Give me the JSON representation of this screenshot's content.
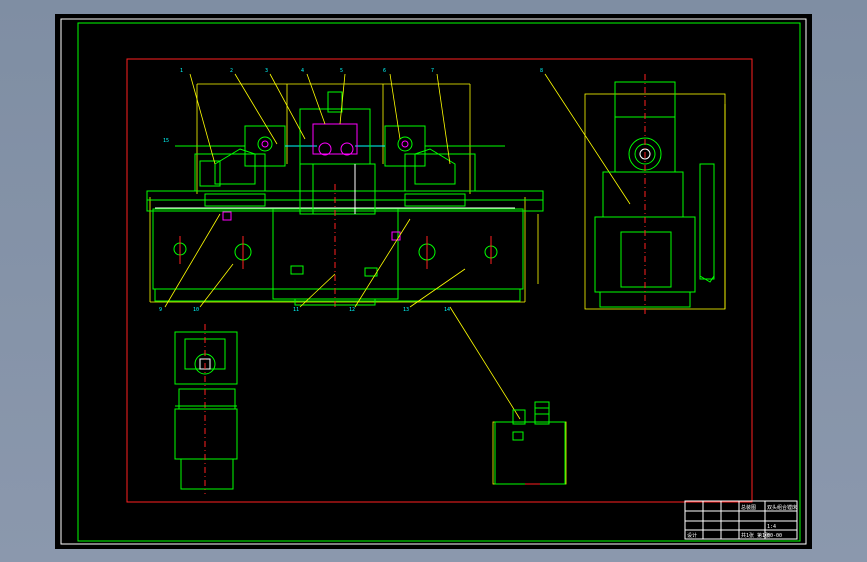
{
  "drawing": {
    "balloons": [
      "1",
      "2",
      "3",
      "4",
      "5",
      "6",
      "7",
      "8",
      "9",
      "10",
      "11",
      "12",
      "13",
      "14",
      "15"
    ],
    "title_block": {
      "name": "总装图",
      "project": "双头组合镗床",
      "drawing_no": "00-00",
      "scale": "1:4",
      "sheet": "共1张 第1张",
      "school": "设计",
      "rows": [
        "标记",
        "处数",
        "分区",
        "更改文件号",
        "签名",
        "日期"
      ]
    },
    "colors": {
      "background": "#000000",
      "outline": "#00ff00",
      "dimension": "#ffff00",
      "centerline": "#ff2020",
      "highlight": "#ff00ff",
      "frame": "#ffffff"
    }
  }
}
